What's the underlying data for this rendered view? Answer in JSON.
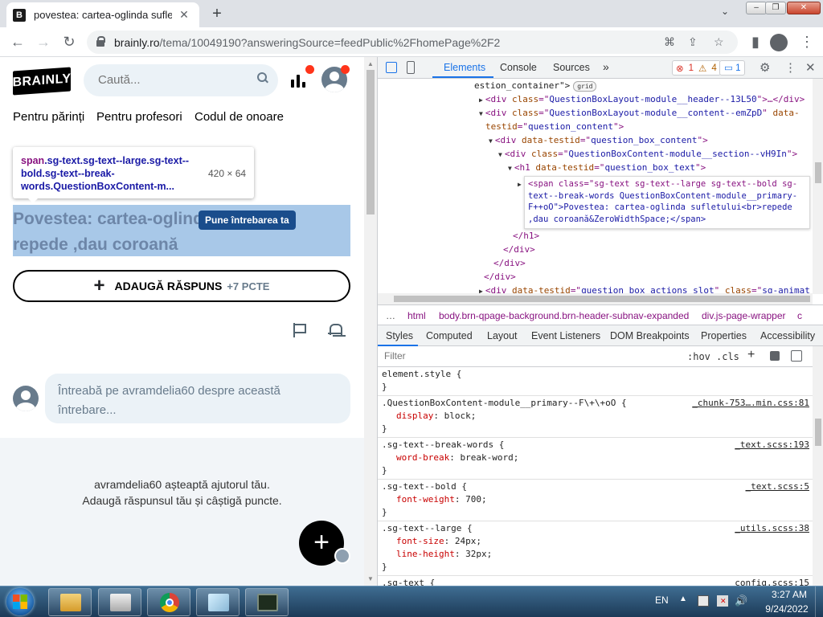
{
  "browser": {
    "tab_title": "povestea: cartea-oglinda sufletului",
    "tab_favicon_letter": "B",
    "tab_close": "✕",
    "new_tab": "+",
    "tab_search": "⌄",
    "url_host": "brainly.ro",
    "url_path": "/tema/10049190?answeringSource=feedPublic%2FhomePage%2F2",
    "icons": [
      "arrow-left-icon",
      "arrow-right-icon",
      "reload-icon",
      "lock-icon",
      "translate-icon",
      "share-icon",
      "star-icon",
      "side-panel-icon",
      "profile-icon",
      "kebab-menu-icon"
    ]
  },
  "page": {
    "logo": "BRAINLY",
    "search_placeholder": "Caută...",
    "nav": [
      "Pentru părinți",
      "Pentru profesori",
      "Codul de onoare"
    ],
    "inspect_tooltip": {
      "tag": "span",
      "selector": ".sg-text.sg-text--large.sg-text--bold.sg-text--break-words.QuestionBoxContent-m...",
      "size": "420 × 64"
    },
    "question_title": "Povestea: cartea-oglinda sufletului repede ,dau coroană",
    "answer_button": "ADAUGĂ RĂSPUNS",
    "answer_points": "+7 PCTE",
    "ask_placeholder": "Întreabă pe avramdelia60 despre această întrebare...",
    "waiting_line1": "avramdelia60 așteaptă ajutorul tău.",
    "waiting_line2": "Adaugă răspunsul tău și câștigă puncte.",
    "ask_question_label": "Pune întrebarea ta",
    "fab_label": "+",
    "accent_color": "#000000",
    "highlight_color": "#a8c8e8"
  },
  "devtools": {
    "tabs": [
      "Elements",
      "Console",
      "Sources",
      "»"
    ],
    "error_count": "1",
    "warning_count": "4",
    "info_count": "1",
    "dom_lines": [
      {
        "indent": 120,
        "parts": [
          [
            "tx",
            "estion_container\">"
          ],
          [
            "badge",
            "grid"
          ]
        ]
      },
      {
        "indent": 126,
        "tri": "▶",
        "parts": [
          [
            "tg",
            "<div "
          ],
          [
            "an",
            "class"
          ],
          [
            "tg",
            "=\""
          ],
          [
            "av",
            "QuestionBoxLayout-module__header--13L50"
          ],
          [
            "tg",
            "\">…</div>"
          ]
        ]
      },
      {
        "indent": 126,
        "tri": "▼",
        "parts": [
          [
            "tg",
            "<div "
          ],
          [
            "an",
            "class"
          ],
          [
            "tg",
            "=\""
          ],
          [
            "av",
            "QuestionBoxLayout-module__content--emZpD"
          ],
          [
            "tg",
            "\" "
          ],
          [
            "an",
            "data-"
          ]
        ]
      },
      {
        "indent": 134,
        "parts": [
          [
            "an",
            "testid"
          ],
          [
            "tg",
            "=\""
          ],
          [
            "av",
            "question_content"
          ],
          [
            "tg",
            "\">"
          ]
        ]
      },
      {
        "indent": 138,
        "tri": "▼",
        "parts": [
          [
            "tg",
            "<div "
          ],
          [
            "an",
            "data-testid"
          ],
          [
            "tg",
            "=\""
          ],
          [
            "av",
            "question_box_content"
          ],
          [
            "tg",
            "\">"
          ]
        ]
      },
      {
        "indent": 150,
        "tri": "▼",
        "parts": [
          [
            "tg",
            "<div "
          ],
          [
            "an",
            "class"
          ],
          [
            "tg",
            "=\""
          ],
          [
            "av",
            "QuestionBoxContent-module__section--vH9In"
          ],
          [
            "tg",
            "\">"
          ]
        ]
      },
      {
        "indent": 162,
        "tri": "▼",
        "parts": [
          [
            "tg",
            "<h1 "
          ],
          [
            "an",
            "data-testid"
          ],
          [
            "tg",
            "=\""
          ],
          [
            "av",
            "question_box_text"
          ],
          [
            "tg",
            "\">"
          ]
        ]
      },
      {
        "indent": 168,
        "parts": [
          [
            "tg",
            "</h1>"
          ]
        ]
      },
      {
        "indent": 156,
        "parts": [
          [
            "tg",
            "</div>"
          ]
        ]
      },
      {
        "indent": 144,
        "parts": [
          [
            "tg",
            "</div>"
          ]
        ]
      },
      {
        "indent": 132,
        "parts": [
          [
            "tg",
            "</div>"
          ]
        ]
      },
      {
        "indent": 126,
        "tri": "▶",
        "parts": [
          [
            "tg",
            "<div "
          ],
          [
            "an",
            "data-testid"
          ],
          [
            "tg",
            "=\""
          ],
          [
            "av",
            "question_box_actions_slot"
          ],
          [
            "tg",
            "\" "
          ],
          [
            "an",
            "class"
          ],
          [
            "tg",
            "=\""
          ],
          [
            "av",
            "sg-animat"
          ]
        ]
      }
    ],
    "selected_span_lines": [
      "<span class=\"sg-text sg-text--large sg-text--bold sg-",
      "text--break-words QuestionBoxContent-module__primary-",
      "F++oO\">Povestea: cartea-oglinda sufletului<br>repede",
      ",dau coroană&ZeroWidthSpace;</span>"
    ],
    "breadcrumbs": [
      "…",
      "html",
      "body.brn-qpage-background.brn-header-subnav-expanded",
      "div.js-page-wrapper",
      "c"
    ],
    "style_tabs": [
      "Styles",
      "Computed",
      "Layout",
      "Event Listeners",
      "DOM Breakpoints",
      "Properties",
      "Accessibility"
    ],
    "filter_placeholder": "Filter",
    "filter_hov": ":hov",
    "filter_cls": ".cls",
    "filter_plus": "+",
    "rules": [
      {
        "selector": "element.style {",
        "source": "",
        "decls": [],
        "close": "}"
      },
      {
        "selector": ".QuestionBoxContent-module__primary--F\\+\\+oO {",
        "source": "_chunk-753….min.css:81",
        "decls": [
          [
            "display",
            "block"
          ]
        ],
        "close": "}"
      },
      {
        "selector": ".sg-text--break-words {",
        "source": "_text.scss:193",
        "decls": [
          [
            "word-break",
            "break-word"
          ]
        ],
        "close": "}"
      },
      {
        "selector": ".sg-text--bold {",
        "source": "_text.scss:5",
        "decls": [
          [
            "font-weight",
            "700"
          ]
        ],
        "close": "}"
      },
      {
        "selector": ".sg-text--large {",
        "source": "_utils.scss:38",
        "decls": [
          [
            "font-size",
            "24px"
          ],
          [
            "line-height",
            "32px"
          ]
        ],
        "close": "}"
      },
      {
        "selector": ".sg-text {",
        "source": "_config.scss:15",
        "decls": [],
        "close": ""
      }
    ]
  },
  "taskbar": {
    "items": [
      "explorer-icon",
      "media-player-icon",
      "chrome-icon",
      "notepad-icon",
      "terminal-icon"
    ],
    "language": "EN",
    "tray_up": "▲",
    "volume": "🔊",
    "time": "3:27 AM",
    "date": "9/24/2022"
  }
}
